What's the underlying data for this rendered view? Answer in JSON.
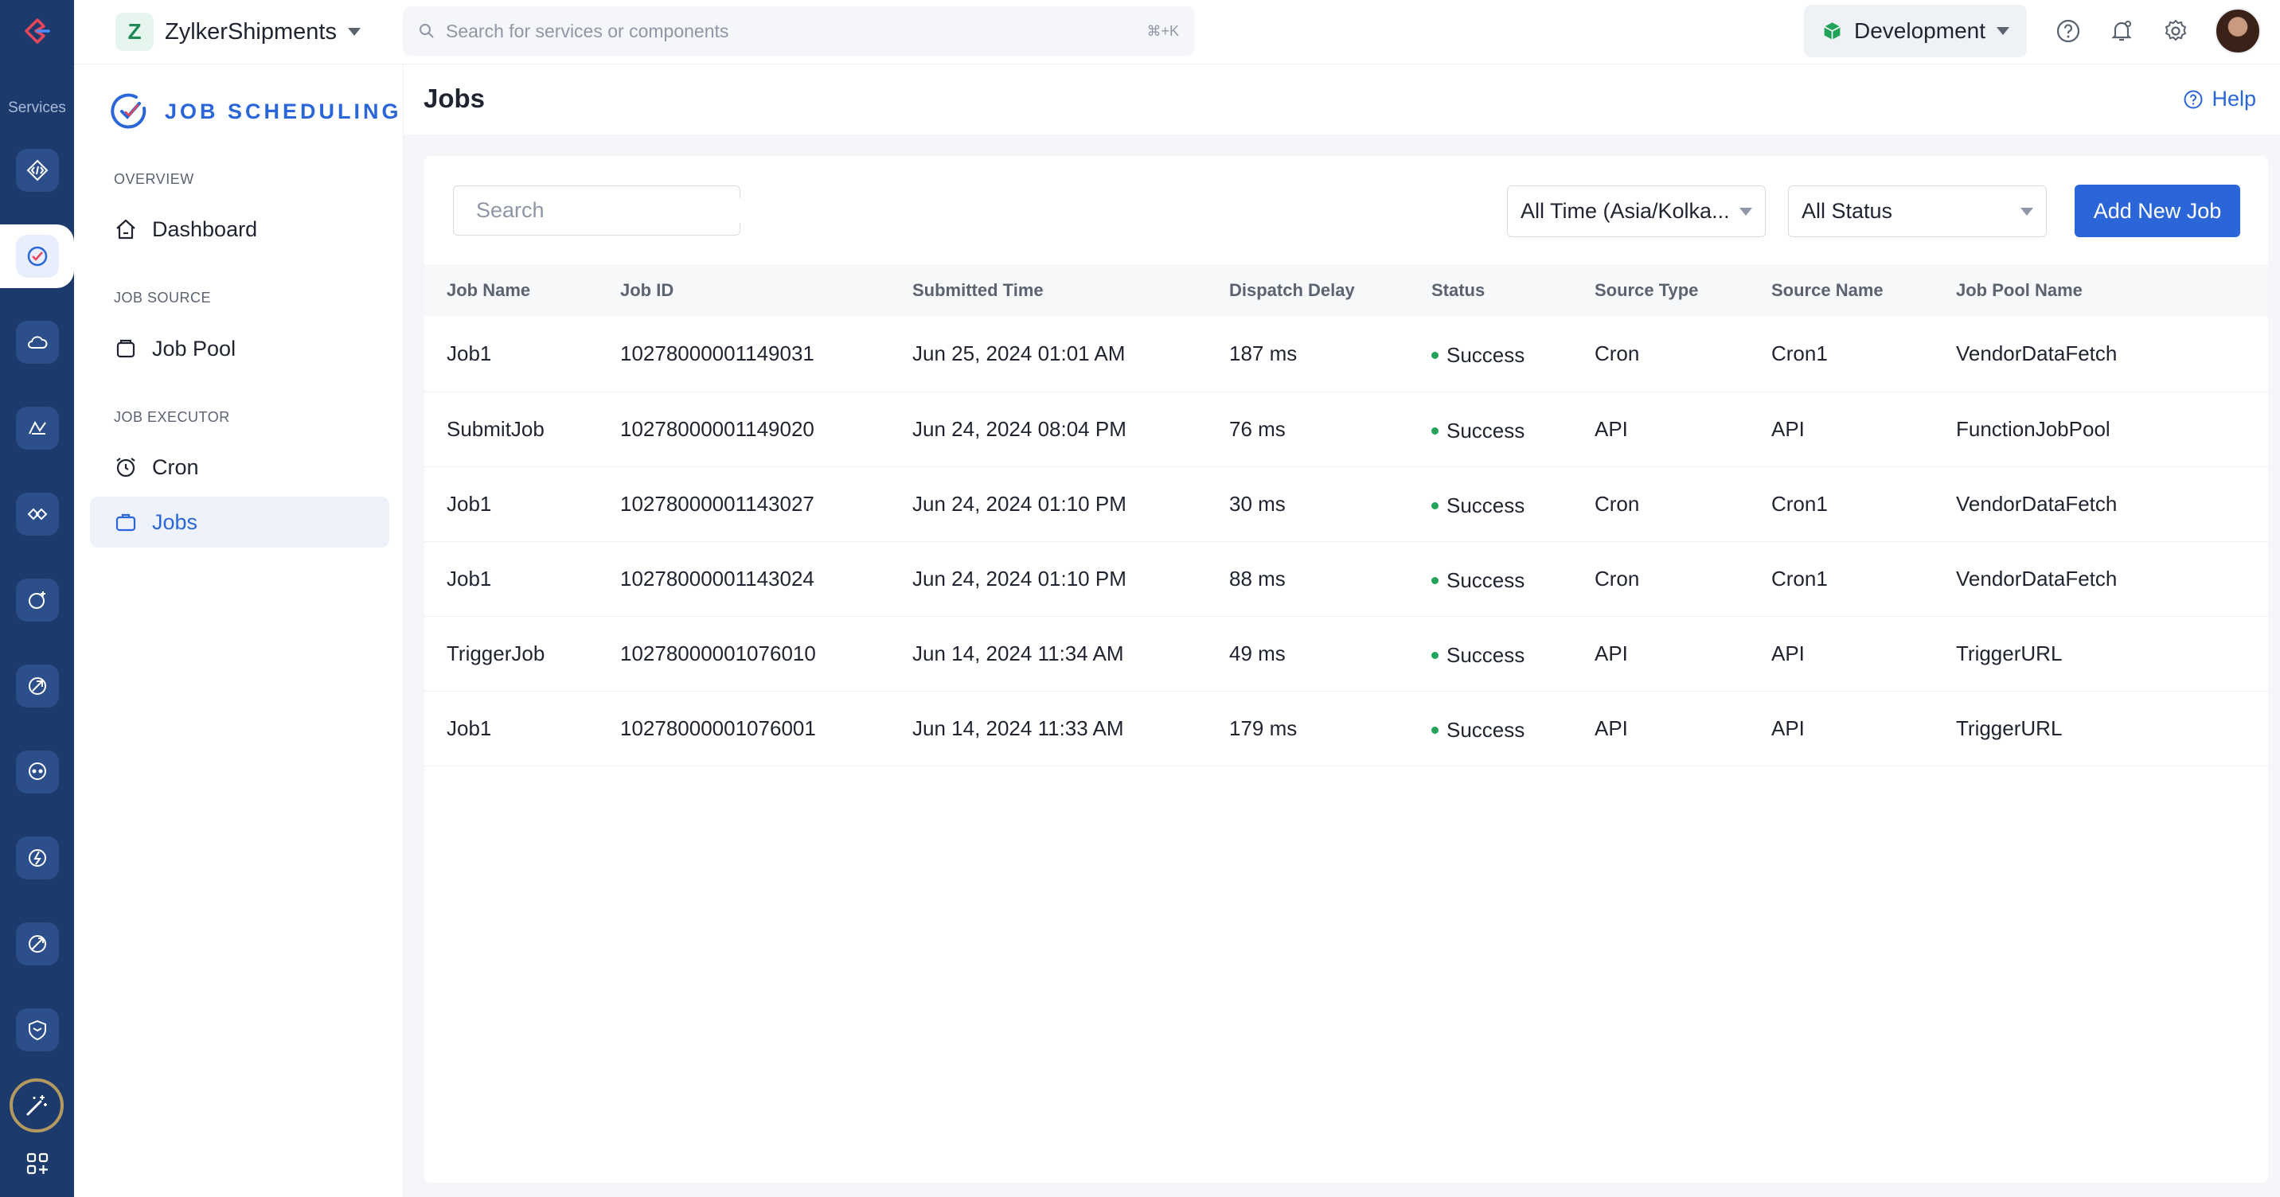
{
  "rail": {
    "label": "Services",
    "icons": [
      "api-gateway-icon",
      "job-scheduling-icon",
      "cloud-scale-icon",
      "data-icon",
      "integrations-icon",
      "signals-icon",
      "serverless-icon",
      "circuits-icon",
      "functions-icon",
      "pipelines-icon",
      "security-icon"
    ],
    "ai_icon": "magic-wand-icon",
    "apps_icon": "add-apps-icon"
  },
  "header": {
    "project_initial": "Z",
    "project_name": "ZylkerShipments",
    "search_placeholder": "Search for services or components",
    "search_shortcut": "⌘+K",
    "environment": "Development",
    "env_color": "#22a35a"
  },
  "sidebar": {
    "service_title": "JOB SCHEDULING",
    "sections": [
      {
        "label": "OVERVIEW",
        "items": [
          {
            "label": "Dashboard",
            "icon": "home-icon"
          }
        ]
      },
      {
        "label": "JOB SOURCE",
        "items": [
          {
            "label": "Job Pool",
            "icon": "job-pool-icon"
          }
        ]
      },
      {
        "label": "JOB EXECUTOR",
        "items": [
          {
            "label": "Cron",
            "icon": "alarm-clock-icon"
          },
          {
            "label": "Jobs",
            "icon": "briefcase-icon",
            "active": true
          }
        ]
      }
    ]
  },
  "page": {
    "title": "Jobs",
    "help": "Help"
  },
  "toolbar": {
    "search_placeholder": "Search",
    "time_filter": "All Time (Asia/Kolka...",
    "status_filter": "All Status",
    "add_button": "Add New Job"
  },
  "table": {
    "columns": [
      "Job Name",
      "Job ID",
      "Submitted Time",
      "Dispatch Delay",
      "Status",
      "Source Type",
      "Source Name",
      "Job Pool Name"
    ],
    "rows": [
      [
        "Job1",
        "10278000001149031",
        "Jun 25, 2024 01:01 AM",
        "187 ms",
        "Success",
        "Cron",
        "Cron1",
        "VendorDataFetch"
      ],
      [
        "SubmitJob",
        "10278000001149020",
        "Jun 24, 2024 08:04 PM",
        "76 ms",
        "Success",
        "API",
        "API",
        "FunctionJobPool"
      ],
      [
        "Job1",
        "10278000001143027",
        "Jun 24, 2024 01:10 PM",
        "30 ms",
        "Success",
        "Cron",
        "Cron1",
        "VendorDataFetch"
      ],
      [
        "Job1",
        "10278000001143024",
        "Jun 24, 2024 01:10 PM",
        "88 ms",
        "Success",
        "Cron",
        "Cron1",
        "VendorDataFetch"
      ],
      [
        "TriggerJob",
        "10278000001076010",
        "Jun 14, 2024 11:34 AM",
        "49 ms",
        "Success",
        "API",
        "API",
        "TriggerURL"
      ],
      [
        "Job1",
        "10278000001076001",
        "Jun 14, 2024 11:33 AM",
        "179 ms",
        "Success",
        "API",
        "API",
        "TriggerURL"
      ]
    ],
    "success_color": "#22a35a"
  },
  "colors": {
    "accent": "#2b66d8",
    "rail_bg": "#1d3a6d"
  }
}
